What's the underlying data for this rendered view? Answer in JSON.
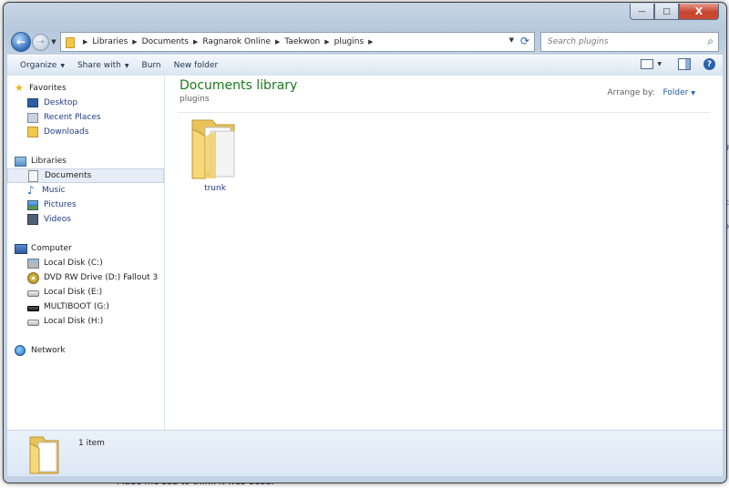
{
  "background": {
    "bottom_text": "Made me sad to think it was dead.",
    "right_label_1": "U",
    "right_link": "ec",
    "right_label_2": "b"
  },
  "window": {
    "buttons": {
      "minimize": "—",
      "maximize": "□",
      "close": "X"
    }
  },
  "address_bar": {
    "breadcrumbs": [
      "Libraries",
      "Documents",
      "Ragnarok Online",
      "Taekwon",
      "plugins"
    ],
    "search_placeholder": "Search plugins"
  },
  "toolbar": {
    "organize": "Organize",
    "share_with": "Share with",
    "burn": "Burn",
    "new_folder": "New folder"
  },
  "nav": {
    "favorites": {
      "label": "Favorites",
      "items": [
        "Desktop",
        "Recent Places",
        "Downloads"
      ]
    },
    "libraries": {
      "label": "Libraries",
      "items": [
        "Documents",
        "Music",
        "Pictures",
        "Videos"
      ],
      "selected": "Documents"
    },
    "computer": {
      "label": "Computer",
      "items": [
        "Local Disk (C:)",
        "DVD RW Drive (D:) Fallout 3",
        "Local Disk (E:)",
        "MULTIBOOT (G:)",
        "Local Disk (H:)"
      ]
    },
    "network": {
      "label": "Network"
    }
  },
  "main": {
    "title": "Documents library",
    "subtitle": "plugins",
    "arrange_by_label": "Arrange by:",
    "arrange_by_value": "Folder",
    "items": [
      {
        "name": "trunk",
        "type": "folder"
      }
    ]
  },
  "details": {
    "count": "1 item"
  }
}
